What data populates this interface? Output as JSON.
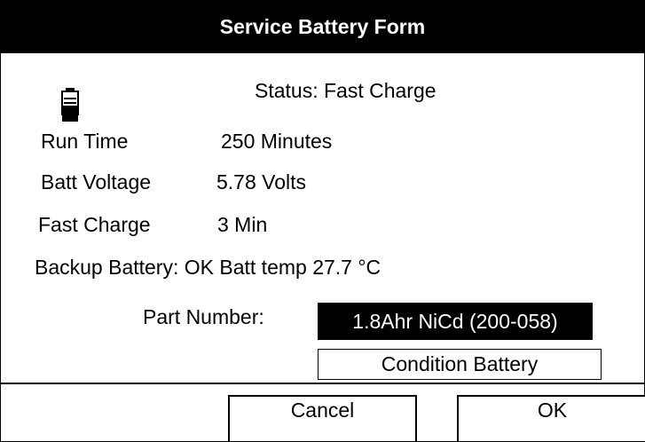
{
  "window": {
    "title": "Service Battery Form"
  },
  "status": {
    "text": "Status: Fast Charge"
  },
  "fields": {
    "run_time_label": "Run Time",
    "run_time_value": "250 Minutes",
    "batt_voltage_label": "Batt Voltage",
    "batt_voltage_value": "5.78 Volts",
    "fast_charge_label": "Fast Charge",
    "fast_charge_value": "3 Min",
    "backup_line": "Backup Battery: OK Batt temp 27.7 °C"
  },
  "part": {
    "label": "Part Number:",
    "value": "1.8Ahr NiCd (200-058)"
  },
  "buttons": {
    "condition": "Condition Battery",
    "cancel": "Cancel",
    "ok": "OK"
  },
  "icons": {
    "battery": "battery-icon"
  }
}
